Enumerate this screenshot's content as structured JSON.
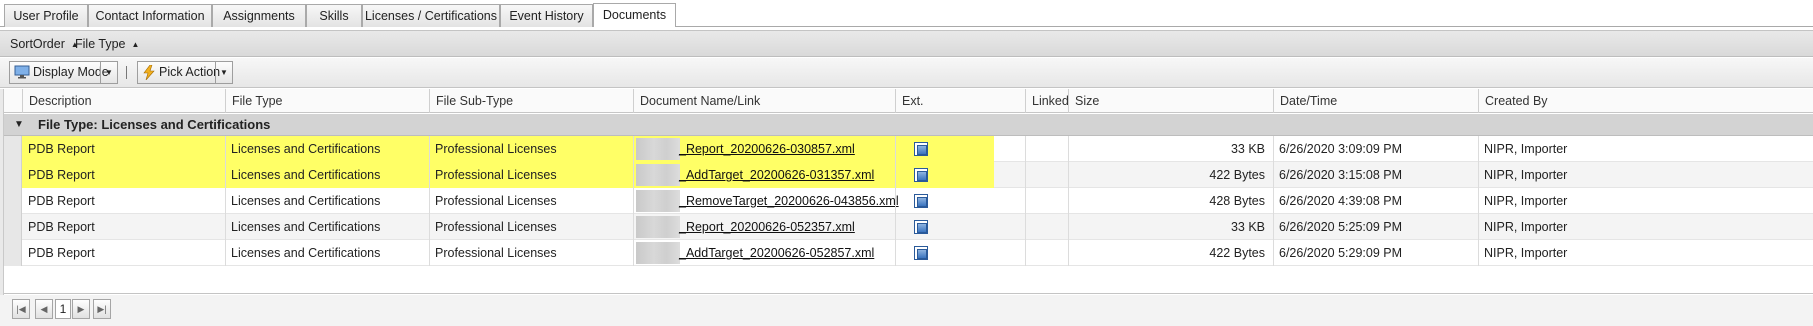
{
  "tabs": [
    {
      "label": "User Profile"
    },
    {
      "label": "Contact Information"
    },
    {
      "label": "Assignments"
    },
    {
      "label": "Skills"
    },
    {
      "label": "Licenses / Certifications"
    },
    {
      "label": "Event History"
    },
    {
      "label": "Documents"
    }
  ],
  "active_tab": "Documents",
  "sortbar": {
    "items": [
      {
        "label": "SortOrder",
        "direction_icon": "sort-ascending-icon"
      },
      {
        "label": "File Type",
        "direction_icon": "sort-ascending-icon"
      }
    ]
  },
  "toolbar": {
    "display_mode_label": "Display Mode",
    "display_mode_icon": "monitor-icon",
    "pick_action_label": "Pick Action",
    "pick_action_icon": "lightning-icon"
  },
  "grid": {
    "columns": [
      "Description",
      "File Type",
      "File Sub-Type",
      "Document Name/Link",
      "Ext.",
      "Linked",
      "Size",
      "Date/Time",
      "Created By"
    ],
    "group_label": "File Type: Licenses and Certifications",
    "rows": [
      {
        "description": "PDB Report",
        "file_type": "Licenses and Certifications",
        "file_sub_type": "Professional Licenses",
        "doc_name": "_Report_20200626-030857.xml",
        "ext_icon": "xml-file-icon",
        "linked": "",
        "size": "33 KB",
        "date_time": "6/26/2020 3:09:09 PM",
        "created_by": "NIPR, Importer",
        "highlighted": true
      },
      {
        "description": "PDB Report",
        "file_type": "Licenses and Certifications",
        "file_sub_type": "Professional Licenses",
        "doc_name": "_AddTarget_20200626-031357.xml",
        "ext_icon": "xml-file-icon",
        "linked": "",
        "size": "422 Bytes",
        "date_time": "6/26/2020 3:15:08 PM",
        "created_by": "NIPR, Importer",
        "highlighted": true
      },
      {
        "description": "PDB Report",
        "file_type": "Licenses and Certifications",
        "file_sub_type": "Professional Licenses",
        "doc_name": "_RemoveTarget_20200626-043856.xml",
        "ext_icon": "xml-file-icon",
        "linked": "",
        "size": "428 Bytes",
        "date_time": "6/26/2020 4:39:08 PM",
        "created_by": "NIPR, Importer",
        "highlighted": false
      },
      {
        "description": "PDB Report",
        "file_type": "Licenses and Certifications",
        "file_sub_type": "Professional Licenses",
        "doc_name": "_Report_20200626-052357.xml",
        "ext_icon": "xml-file-icon",
        "linked": "",
        "size": "33 KB",
        "date_time": "6/26/2020 5:25:09 PM",
        "created_by": "NIPR, Importer",
        "highlighted": false
      },
      {
        "description": "PDB Report",
        "file_type": "Licenses and Certifications",
        "file_sub_type": "Professional Licenses",
        "doc_name": "_AddTarget_20200626-052857.xml",
        "ext_icon": "xml-file-icon",
        "linked": "",
        "size": "422 Bytes",
        "date_time": "6/26/2020 5:29:09 PM",
        "created_by": "NIPR, Importer",
        "highlighted": false
      }
    ]
  },
  "pager": {
    "current_page": "1",
    "first_icon": "first-page-icon",
    "prev_icon": "prev-page-icon",
    "next_icon": "next-page-icon",
    "last_icon": "last-page-icon"
  },
  "colors": {
    "highlight": "#ffff66",
    "group_row": "#d3d3d3"
  }
}
